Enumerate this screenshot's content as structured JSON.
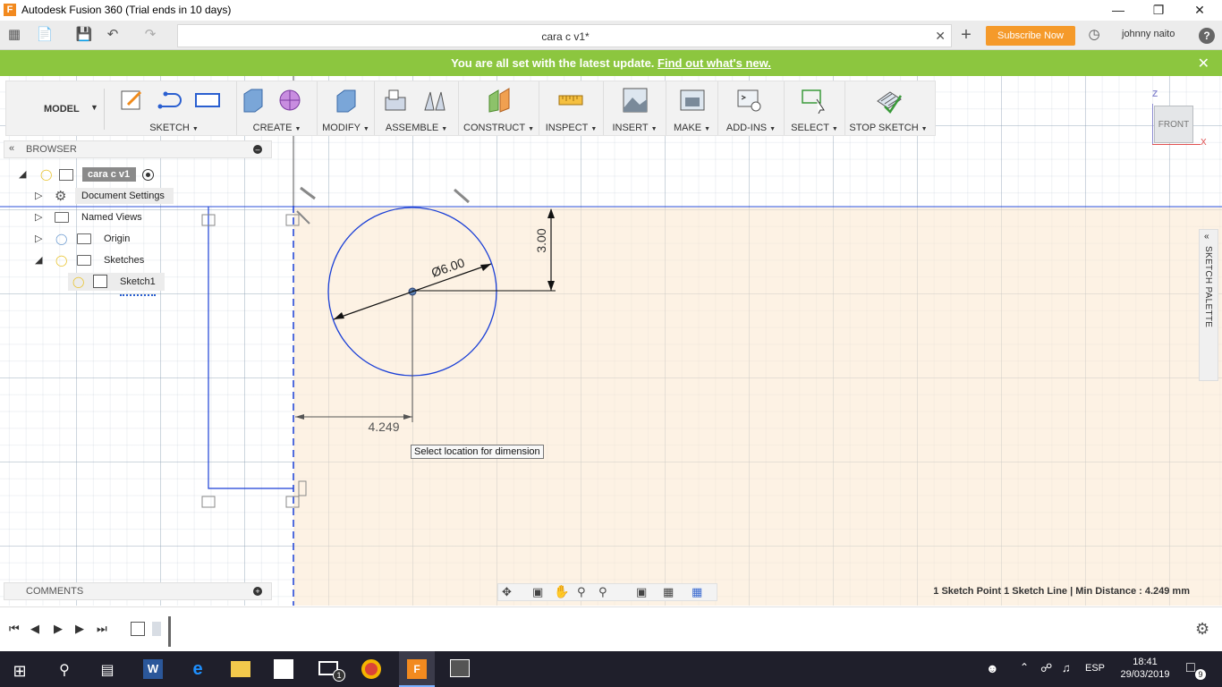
{
  "window": {
    "title": "Autodesk Fusion 360 (Trial ends in 10 days)",
    "controls": [
      "minimize",
      "restore",
      "close"
    ]
  },
  "appbar": {
    "document_tab": "cara c v1*",
    "subscribe_label": "Subscribe Now",
    "user_name": "johnny naito",
    "help_label": "?"
  },
  "banner": {
    "message": "You are all set with the latest update.",
    "link_text": "Find out what's new."
  },
  "toolbar": {
    "workspace": "MODEL",
    "groups": [
      {
        "label": "SKETCH"
      },
      {
        "label": "CREATE"
      },
      {
        "label": "MODIFY"
      },
      {
        "label": "ASSEMBLE"
      },
      {
        "label": "CONSTRUCT"
      },
      {
        "label": "INSPECT"
      },
      {
        "label": "INSERT"
      },
      {
        "label": "MAKE"
      },
      {
        "label": "ADD-INS"
      },
      {
        "label": "SELECT"
      },
      {
        "label": "STOP SKETCH"
      }
    ]
  },
  "viewcube": {
    "face": "FRONT",
    "axis_z": "Z",
    "axis_x": "X"
  },
  "browser": {
    "title": "BROWSER",
    "root": "cara c v1",
    "items": [
      {
        "label": "Document Settings"
      },
      {
        "label": "Named Views"
      },
      {
        "label": "Origin"
      },
      {
        "label": "Sketches"
      },
      {
        "label": "Sketch1"
      }
    ]
  },
  "sketch": {
    "diameter_dim": "Ø6.00",
    "vertical_dim": "3.00",
    "horizontal_dim": "4.249",
    "tooltip": "Select location for dimension"
  },
  "palette": {
    "label": "SKETCH PALETTE"
  },
  "comments": {
    "title": "COMMENTS"
  },
  "status": {
    "text": "1 Sketch Point 1 Sketch Line | Min Distance : 4.249 mm"
  },
  "taskbar": {
    "language": "ESP",
    "time": "18:41",
    "date": "29/03/2019",
    "notification_count": "9",
    "mail_badge": "1"
  },
  "colors": {
    "banner": "#8cc63f",
    "subscribe": "#f59a2a",
    "sketch_line": "#1a3fd6",
    "workplane": "#fce8cd"
  }
}
